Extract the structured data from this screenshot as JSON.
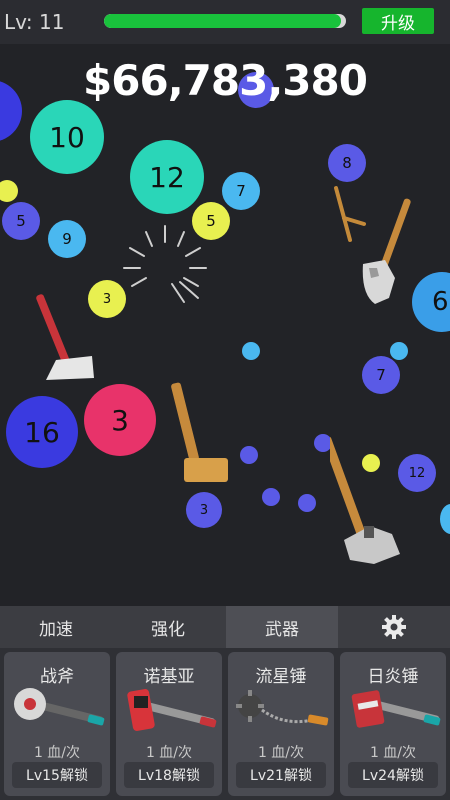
{
  "header": {
    "level_label": "Lv:",
    "level_value": "11",
    "xp_progress": 0.98,
    "upgrade_label": "升级"
  },
  "money": "$66,783,380",
  "orbs": [
    {
      "label": "10",
      "color": "#2ad6b8"
    },
    {
      "label": "12",
      "color": "#2ad6b8"
    },
    {
      "label": "8",
      "color": "#5a5ae6"
    },
    {
      "label": "7",
      "color": "#4ab8f0"
    },
    {
      "label": "5",
      "color": "#5a5ae6"
    },
    {
      "label": "9",
      "color": "#4ab8f0"
    },
    {
      "label": "5",
      "color": "#e8f050"
    },
    {
      "label": "3",
      "color": "#e8f050"
    },
    {
      "label": "6",
      "color": "#3a9ee8"
    },
    {
      "label": "7",
      "color": "#5a5ae6"
    },
    {
      "label": "16",
      "color": "#3a3ae0"
    },
    {
      "label": "3",
      "color": "#e8336a"
    },
    {
      "label": "12",
      "color": "#5a5ae6"
    },
    {
      "label": "3",
      "color": "#5a5ae6"
    }
  ],
  "tabs": [
    {
      "label": "加速"
    },
    {
      "label": "强化"
    },
    {
      "label": "武器"
    },
    {
      "label": "settings"
    }
  ],
  "weapons": [
    {
      "name": "战斧",
      "damage": "1 血/次",
      "unlock": "Lv15解锁"
    },
    {
      "name": "诺基亚",
      "damage": "1 血/次",
      "unlock": "Lv18解锁"
    },
    {
      "name": "流星锤",
      "damage": "1 血/次",
      "unlock": "Lv21解锁"
    },
    {
      "name": "日炎锤",
      "damage": "1 血/次",
      "unlock": "Lv24解锁"
    }
  ]
}
